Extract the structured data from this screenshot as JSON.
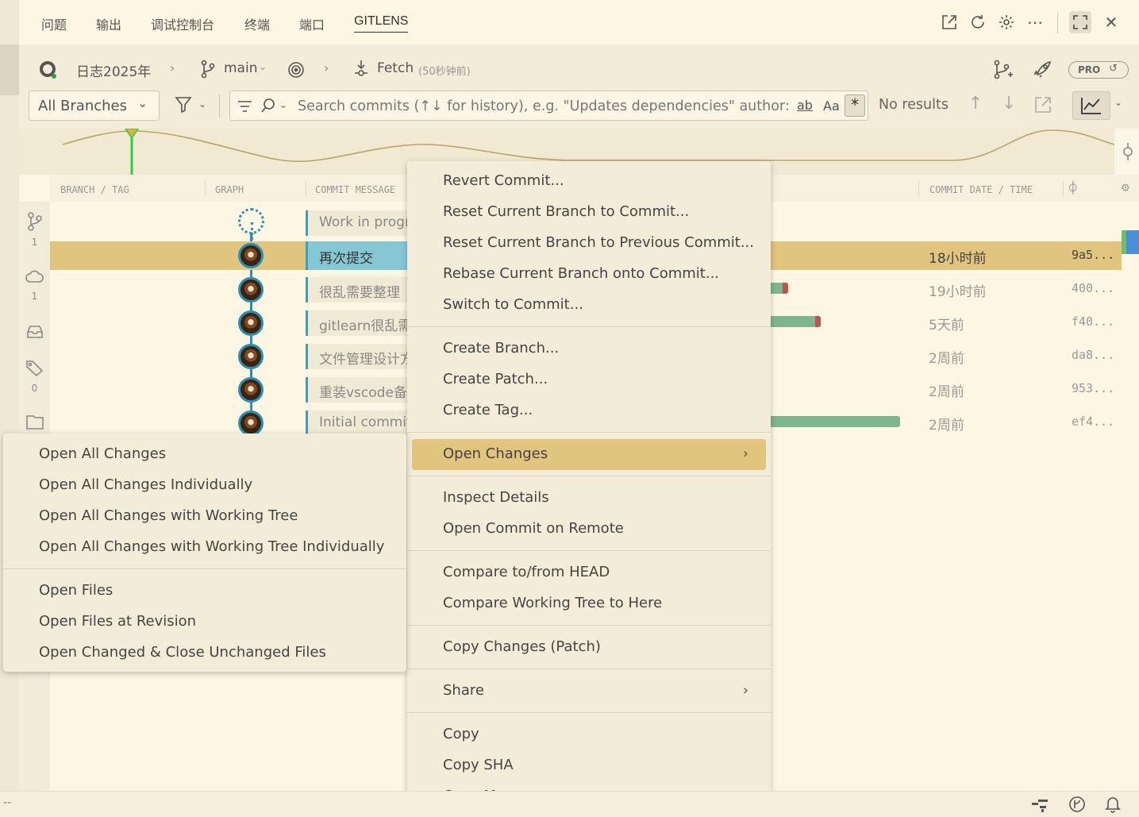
{
  "tabs": [
    {
      "label": "问题"
    },
    {
      "label": "输出"
    },
    {
      "label": "调试控制台"
    },
    {
      "label": "终端"
    },
    {
      "label": "端口"
    },
    {
      "label": "GITLENS"
    }
  ],
  "header": {
    "repo": "日志2025年",
    "branch": "main",
    "fetch_label": "Fetch",
    "fetch_time": "(50秒钟前)",
    "pro_badge": "PRO"
  },
  "search": {
    "branch_filter": "All Branches",
    "placeholder": "Search commits (↑↓ for history), e.g. \"Updates dependencies\" author:ean",
    "match_word": "ab",
    "match_case": "Aa",
    "regex": "*",
    "results": "No results"
  },
  "columns": {
    "branch_tag": "BRANCH / TAG",
    "graph": "GRAPH",
    "commit_message": "COMMIT MESSAGE",
    "commit_date": "COMMIT DATE / TIME"
  },
  "activity": {
    "branches_count": "1",
    "remotes_count": "1",
    "tags_count": "0"
  },
  "branch_label": {
    "name": "main"
  },
  "commits": [
    {
      "message": "Work in progre",
      "date": "",
      "sha": ""
    },
    {
      "message": "再次提交",
      "date": "18小时前",
      "sha": "9a5..."
    },
    {
      "message": "很乱需要整理",
      "date": "19小时前",
      "sha": "400..."
    },
    {
      "message": "gitlearn很乱需",
      "date": "5天前",
      "sha": "f40..."
    },
    {
      "message": "文件管理设计方",
      "date": "2周前",
      "sha": "da8..."
    },
    {
      "message": "重装vscode备份",
      "date": "2周前",
      "sha": "953..."
    },
    {
      "message": "Initial commit",
      "date": "2周前",
      "sha": "ef4..."
    }
  ],
  "context_menu": {
    "items": [
      "Revert Commit...",
      "Reset Current Branch to Commit...",
      "Reset Current Branch to Previous Commit...",
      "Rebase Current Branch onto Commit...",
      "Switch to Commit...",
      "Create Branch...",
      "Create Patch...",
      "Create Tag...",
      "Open Changes",
      "Inspect Details",
      "Open Commit on Remote",
      "Compare to/from HEAD",
      "Compare Working Tree to Here",
      "Copy Changes (Patch)",
      "Share",
      "Copy",
      "Copy SHA",
      "Copy Message"
    ]
  },
  "submenu": {
    "items": [
      "Open All Changes",
      "Open All Changes Individually",
      "Open All Changes with Working Tree",
      "Open All Changes with Working Tree Individually",
      "Open Files",
      "Open Files at Revision",
      "Open Changed & Close Unchanged Files"
    ]
  },
  "status": {
    "left": "--"
  },
  "colors": {
    "accent": "#2b8fb5",
    "selected_row": "#e1c47e",
    "menu_bg": "#f3ecd9",
    "background": "#fdf6e3"
  }
}
